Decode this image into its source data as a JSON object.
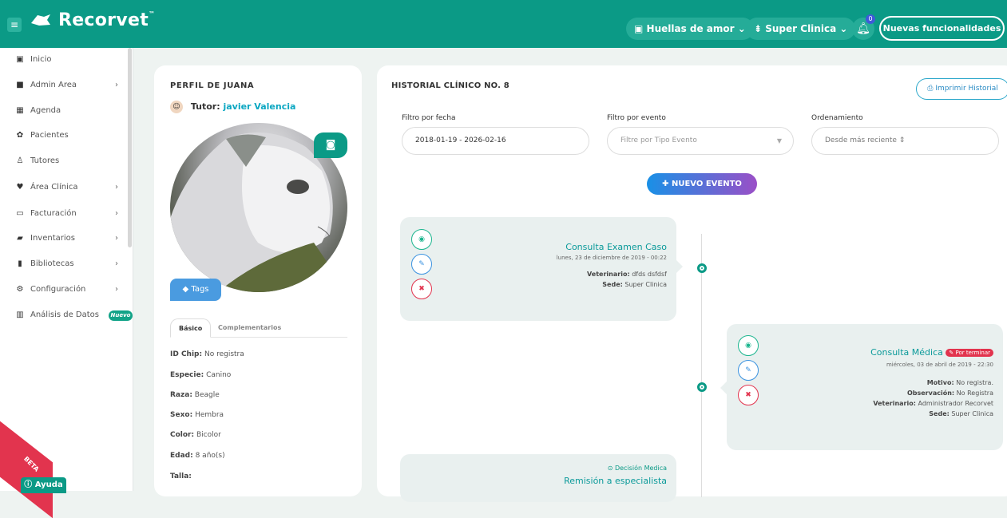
{
  "topbar": {
    "menu_icon": "hamburger-icon",
    "logo": "Recorvet",
    "logo_tm": "™",
    "clinic_selector": "Huellas de amor",
    "branch_selector": "Super Clinica",
    "notification_count": "0",
    "new_features_label": "Nuevas funcionalidades"
  },
  "sidebar": {
    "items": [
      {
        "label": "Inicio",
        "icon": "hospital-icon"
      },
      {
        "label": "Admin Area",
        "icon": "lock-icon"
      },
      {
        "label": "Agenda",
        "icon": "calendar-icon"
      },
      {
        "label": "Pacientes",
        "icon": "paw-icon"
      },
      {
        "label": "Tutores",
        "icon": "user-icon"
      },
      {
        "label": "Área Clínica",
        "icon": "heartbeat-icon"
      },
      {
        "label": "Facturación",
        "icon": "money-icon"
      },
      {
        "label": "Inventarios",
        "icon": "truck-icon"
      },
      {
        "label": "Bibliotecas",
        "icon": "book-icon"
      },
      {
        "label": "Configuración",
        "icon": "gears-icon"
      },
      {
        "label": "Análisis de Datos",
        "icon": "bar-chart-icon"
      }
    ],
    "nuevo_badge": "Nuevo",
    "ribbon_text": "BETA",
    "help_label": "Ayuda"
  },
  "profile": {
    "title": "PERFIL DE JUANA",
    "tutor_label": "Tutor:",
    "tutor_name": "javier Valencia",
    "tags_label": "Tags",
    "tabs": [
      "Básico",
      "Complementarios"
    ],
    "fields": [
      {
        "label": "ID Chip:",
        "value": "No registra"
      },
      {
        "label": "Especie:",
        "value": "Canino"
      },
      {
        "label": "Raza:",
        "value": "Beagle"
      },
      {
        "label": "Sexo:",
        "value": "Hembra"
      },
      {
        "label": "Color:",
        "value": "Bicolor"
      },
      {
        "label": "Edad:",
        "value": "8 año(s)"
      },
      {
        "label": "Talla:",
        "value": ""
      }
    ]
  },
  "historial": {
    "title": "HISTORIAL CLÍNICO NO. 8",
    "print_label": "Imprimir Historial",
    "filters": {
      "fecha_label": "Filtro por fecha",
      "fecha_value": "2018-01-19 - 2026-02-16",
      "evento_label": "Filtro por evento",
      "evento_placeholder": "Filtre por Tipo Evento",
      "orden_label": "Ordenamiento",
      "orden_value": "Desde más reciente"
    },
    "new_event_label": "NUEVO EVENTO",
    "events": [
      {
        "title": "Consulta Examen Caso",
        "date": "lunes, 23 de diciembre de 2019 - 00:22",
        "lines": [
          {
            "label": "Veterinario:",
            "value": "dfds dsfdsf"
          },
          {
            "label": "Sede:",
            "value": "Super Clinica"
          }
        ]
      },
      {
        "title": "Consulta Médica",
        "badge": "Por terminar",
        "date": "miércoles, 03 de abril de 2019 - 22:30",
        "lines": [
          {
            "label": "Motivo:",
            "value": "No registra."
          },
          {
            "label": "Observación:",
            "value": "No Registra"
          },
          {
            "label": "Veterinario:",
            "value": "Administrador Recorvet"
          },
          {
            "label": "Sede:",
            "value": "Super Clinica"
          }
        ]
      },
      {
        "tag": "Decisión Medica",
        "title": "Remisión a especialista"
      }
    ]
  }
}
